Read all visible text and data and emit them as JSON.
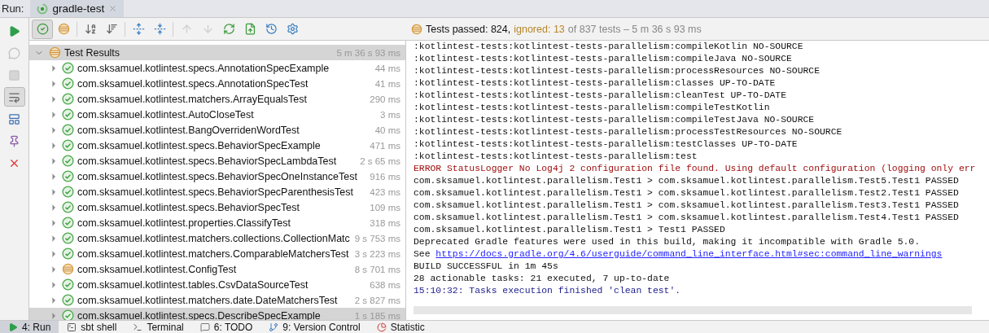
{
  "run_bar": {
    "label": "Run:",
    "tab": {
      "title": "gradle-test",
      "selected": true
    }
  },
  "side_toolbar": [
    {
      "kind": "run",
      "selected": false,
      "disabled": false
    },
    {
      "kind": "debug",
      "selected": false,
      "disabled": true
    },
    {
      "kind": "stop",
      "selected": false,
      "disabled": true
    },
    {
      "kind": "soft-wrap",
      "selected": true,
      "disabled": false
    },
    {
      "kind": "layout",
      "selected": false,
      "disabled": false
    },
    {
      "kind": "pin",
      "selected": false,
      "disabled": false
    },
    {
      "kind": "close",
      "selected": false,
      "disabled": false
    }
  ],
  "toolbar": [
    {
      "kind": "show-passed",
      "selected": true,
      "disabled": false
    },
    {
      "kind": "show-ignored",
      "selected": false,
      "disabled": false
    },
    {
      "kind": "sort-alpha",
      "selected": false,
      "disabled": false
    },
    {
      "kind": "sort-duration",
      "selected": false,
      "disabled": false
    },
    {
      "kind": "expand-all",
      "selected": false,
      "disabled": false
    },
    {
      "kind": "collapse-all",
      "selected": false,
      "disabled": false
    },
    {
      "kind": "previous",
      "selected": false,
      "disabled": true
    },
    {
      "kind": "next",
      "selected": false,
      "disabled": true
    },
    {
      "kind": "rerun",
      "selected": false,
      "disabled": false
    },
    {
      "kind": "export",
      "selected": false,
      "disabled": false
    },
    {
      "kind": "history",
      "selected": false,
      "disabled": false
    },
    {
      "kind": "settings",
      "selected": false,
      "disabled": false
    }
  ],
  "status": {
    "passed": "Tests passed: 824,",
    "ignored": "ignored: 13",
    "rest": "of 837 tests – 5 m 36 s 93 ms"
  },
  "tree": {
    "root": {
      "name": "Test Results",
      "time": "5 m 36 s 93 ms",
      "kind": "ignored",
      "expanded": true,
      "selected": true
    },
    "children": [
      {
        "name": "com.sksamuel.kotlintest.specs.AnnotationSpecExample",
        "time": "44 ms",
        "kind": "passed",
        "selected": false
      },
      {
        "name": "com.sksamuel.kotlintest.specs.AnnotationSpecTest",
        "time": "41 ms",
        "kind": "passed",
        "selected": false
      },
      {
        "name": "com.sksamuel.kotlintest.matchers.ArrayEqualsTest",
        "time": "290 ms",
        "kind": "passed",
        "selected": false
      },
      {
        "name": "com.sksamuel.kotlintest.AutoCloseTest",
        "time": "3 ms",
        "kind": "passed",
        "selected": false
      },
      {
        "name": "com.sksamuel.kotlintest.BangOverridenWordTest",
        "time": "40 ms",
        "kind": "passed",
        "selected": false
      },
      {
        "name": "com.sksamuel.kotlintest.specs.BehaviorSpecExample",
        "time": "471 ms",
        "kind": "passed",
        "selected": false
      },
      {
        "name": "com.sksamuel.kotlintest.specs.BehaviorSpecLambdaTest",
        "time": "2 s 65 ms",
        "kind": "passed",
        "selected": false
      },
      {
        "name": "com.sksamuel.kotlintest.specs.BehaviorSpecOneInstanceTest",
        "time": "916 ms",
        "kind": "passed",
        "selected": false
      },
      {
        "name": "com.sksamuel.kotlintest.specs.BehaviorSpecParenthesisTest",
        "time": "423 ms",
        "kind": "passed",
        "selected": false
      },
      {
        "name": "com.sksamuel.kotlintest.specs.BehaviorSpecTest",
        "time": "109 ms",
        "kind": "passed",
        "selected": false
      },
      {
        "name": "com.sksamuel.kotlintest.properties.ClassifyTest",
        "time": "318 ms",
        "kind": "passed",
        "selected": false
      },
      {
        "name": "com.sksamuel.kotlintest.matchers.collections.CollectionMatc",
        "time": "9 s 753 ms",
        "kind": "passed",
        "selected": false
      },
      {
        "name": "com.sksamuel.kotlintest.matchers.ComparableMatchersTest",
        "time": "3 s 223 ms",
        "kind": "passed",
        "selected": false
      },
      {
        "name": "com.sksamuel.kotlintest.ConfigTest",
        "time": "8 s 701 ms",
        "kind": "ignored",
        "selected": false
      },
      {
        "name": "com.sksamuel.kotlintest.tables.CsvDataSourceTest",
        "time": "638 ms",
        "kind": "passed",
        "selected": false
      },
      {
        "name": "com.sksamuel.kotlintest.matchers.date.DateMatchersTest",
        "time": "2 s 827 ms",
        "kind": "passed",
        "selected": false
      },
      {
        "name": "com.sksamuel.kotlintest.specs.DescribeSpecExample",
        "time": "1 s 185 ms",
        "kind": "passed",
        "selected": true
      }
    ]
  },
  "console": [
    {
      "kind": "plain",
      "text": ":kotlintest-tests:kotlintest-tests-parallelism:compileKotlin NO-SOURCE"
    },
    {
      "kind": "plain",
      "text": ":kotlintest-tests:kotlintest-tests-parallelism:compileJava NO-SOURCE"
    },
    {
      "kind": "plain",
      "text": ":kotlintest-tests:kotlintest-tests-parallelism:processResources NO-SOURCE"
    },
    {
      "kind": "plain",
      "text": ":kotlintest-tests:kotlintest-tests-parallelism:classes UP-TO-DATE"
    },
    {
      "kind": "plain",
      "text": ":kotlintest-tests:kotlintest-tests-parallelism:cleanTest UP-TO-DATE"
    },
    {
      "kind": "plain",
      "text": ":kotlintest-tests:kotlintest-tests-parallelism:compileTestKotlin"
    },
    {
      "kind": "plain",
      "text": ":kotlintest-tests:kotlintest-tests-parallelism:compileTestJava NO-SOURCE"
    },
    {
      "kind": "plain",
      "text": ":kotlintest-tests:kotlintest-tests-parallelism:processTestResources NO-SOURCE"
    },
    {
      "kind": "plain",
      "text": ":kotlintest-tests:kotlintest-tests-parallelism:testClasses UP-TO-DATE"
    },
    {
      "kind": "plain",
      "text": ":kotlintest-tests:kotlintest-tests-parallelism:test"
    },
    {
      "kind": "error",
      "text": "ERROR StatusLogger No Log4j 2 configuration file found. Using default configuration (logging only err"
    },
    {
      "kind": "plain",
      "text": "com.sksamuel.kotlintest.parallelism.Test1 > com.sksamuel.kotlintest.parallelism.Test5.Test1 PASSED"
    },
    {
      "kind": "plain",
      "text": "com.sksamuel.kotlintest.parallelism.Test1 > com.sksamuel.kotlintest.parallelism.Test2.Test1 PASSED"
    },
    {
      "kind": "plain",
      "text": "com.sksamuel.kotlintest.parallelism.Test1 > com.sksamuel.kotlintest.parallelism.Test3.Test1 PASSED"
    },
    {
      "kind": "plain",
      "text": "com.sksamuel.kotlintest.parallelism.Test1 > com.sksamuel.kotlintest.parallelism.Test4.Test1 PASSED"
    },
    {
      "kind": "plain",
      "text": "com.sksamuel.kotlintest.parallelism.Test1 > Test1 PASSED"
    },
    {
      "kind": "plain",
      "text": "Deprecated Gradle features were used in this build, making it incompatible with Gradle 5.0."
    },
    {
      "kind": "link",
      "text": "See",
      "link": "https://docs.gradle.org/4.6/userguide/command_line_interface.html#sec:command_line_warnings"
    },
    {
      "kind": "plain",
      "text": "BUILD SUCCESSFUL in 1m 45s"
    },
    {
      "kind": "plain",
      "text": "28 actionable tasks: 21 executed, 7 up-to-date"
    },
    {
      "kind": "info",
      "text": "15:10:32: Tasks execution finished 'clean test'."
    }
  ],
  "bottom_tabs": [
    {
      "kind": "run",
      "label": "4: Run",
      "selected": true
    },
    {
      "kind": "sbt",
      "label": "sbt shell",
      "selected": false
    },
    {
      "kind": "terminal",
      "label": "Terminal",
      "selected": false
    },
    {
      "kind": "todo",
      "label": "6: TODO",
      "selected": false
    },
    {
      "kind": "vcs",
      "label": "9: Version Control",
      "selected": false
    },
    {
      "kind": "statistic",
      "label": "Statistic",
      "selected": false
    }
  ]
}
